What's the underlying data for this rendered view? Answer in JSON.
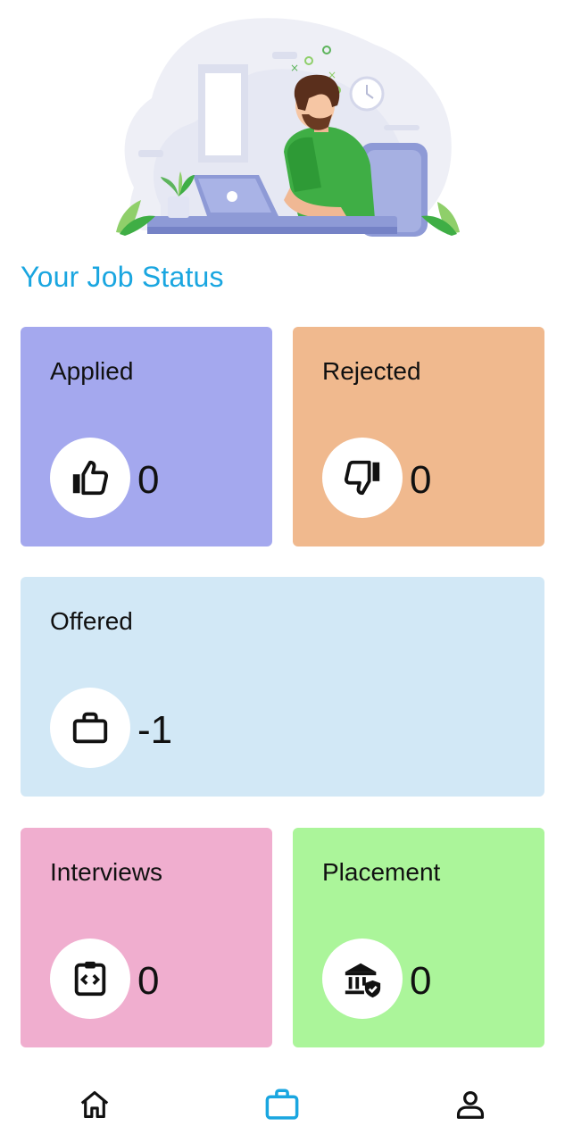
{
  "section": {
    "title": "Your Job Status"
  },
  "cards": [
    {
      "label": "Applied",
      "value": "0",
      "icon": "thumbs-up-icon",
      "color": "#a4a8ee"
    },
    {
      "label": "Rejected",
      "value": "0",
      "icon": "thumbs-down-icon",
      "color": "#f0b98e"
    },
    {
      "label": "Offered",
      "value": "-1",
      "icon": "briefcase-icon",
      "color": "#d2e8f6"
    },
    {
      "label": "Interviews",
      "value": "0",
      "icon": "code-clipboard-icon",
      "color": "#f0aecf"
    },
    {
      "label": "Placement",
      "value": "0",
      "icon": "bank-shield-icon",
      "color": "#abf59a"
    }
  ],
  "nav": {
    "items": [
      {
        "icon": "home-icon",
        "active": false
      },
      {
        "icon": "briefcase-icon",
        "active": true
      },
      {
        "icon": "profile-icon",
        "active": false
      }
    ],
    "active_color": "#1aa6e0"
  }
}
